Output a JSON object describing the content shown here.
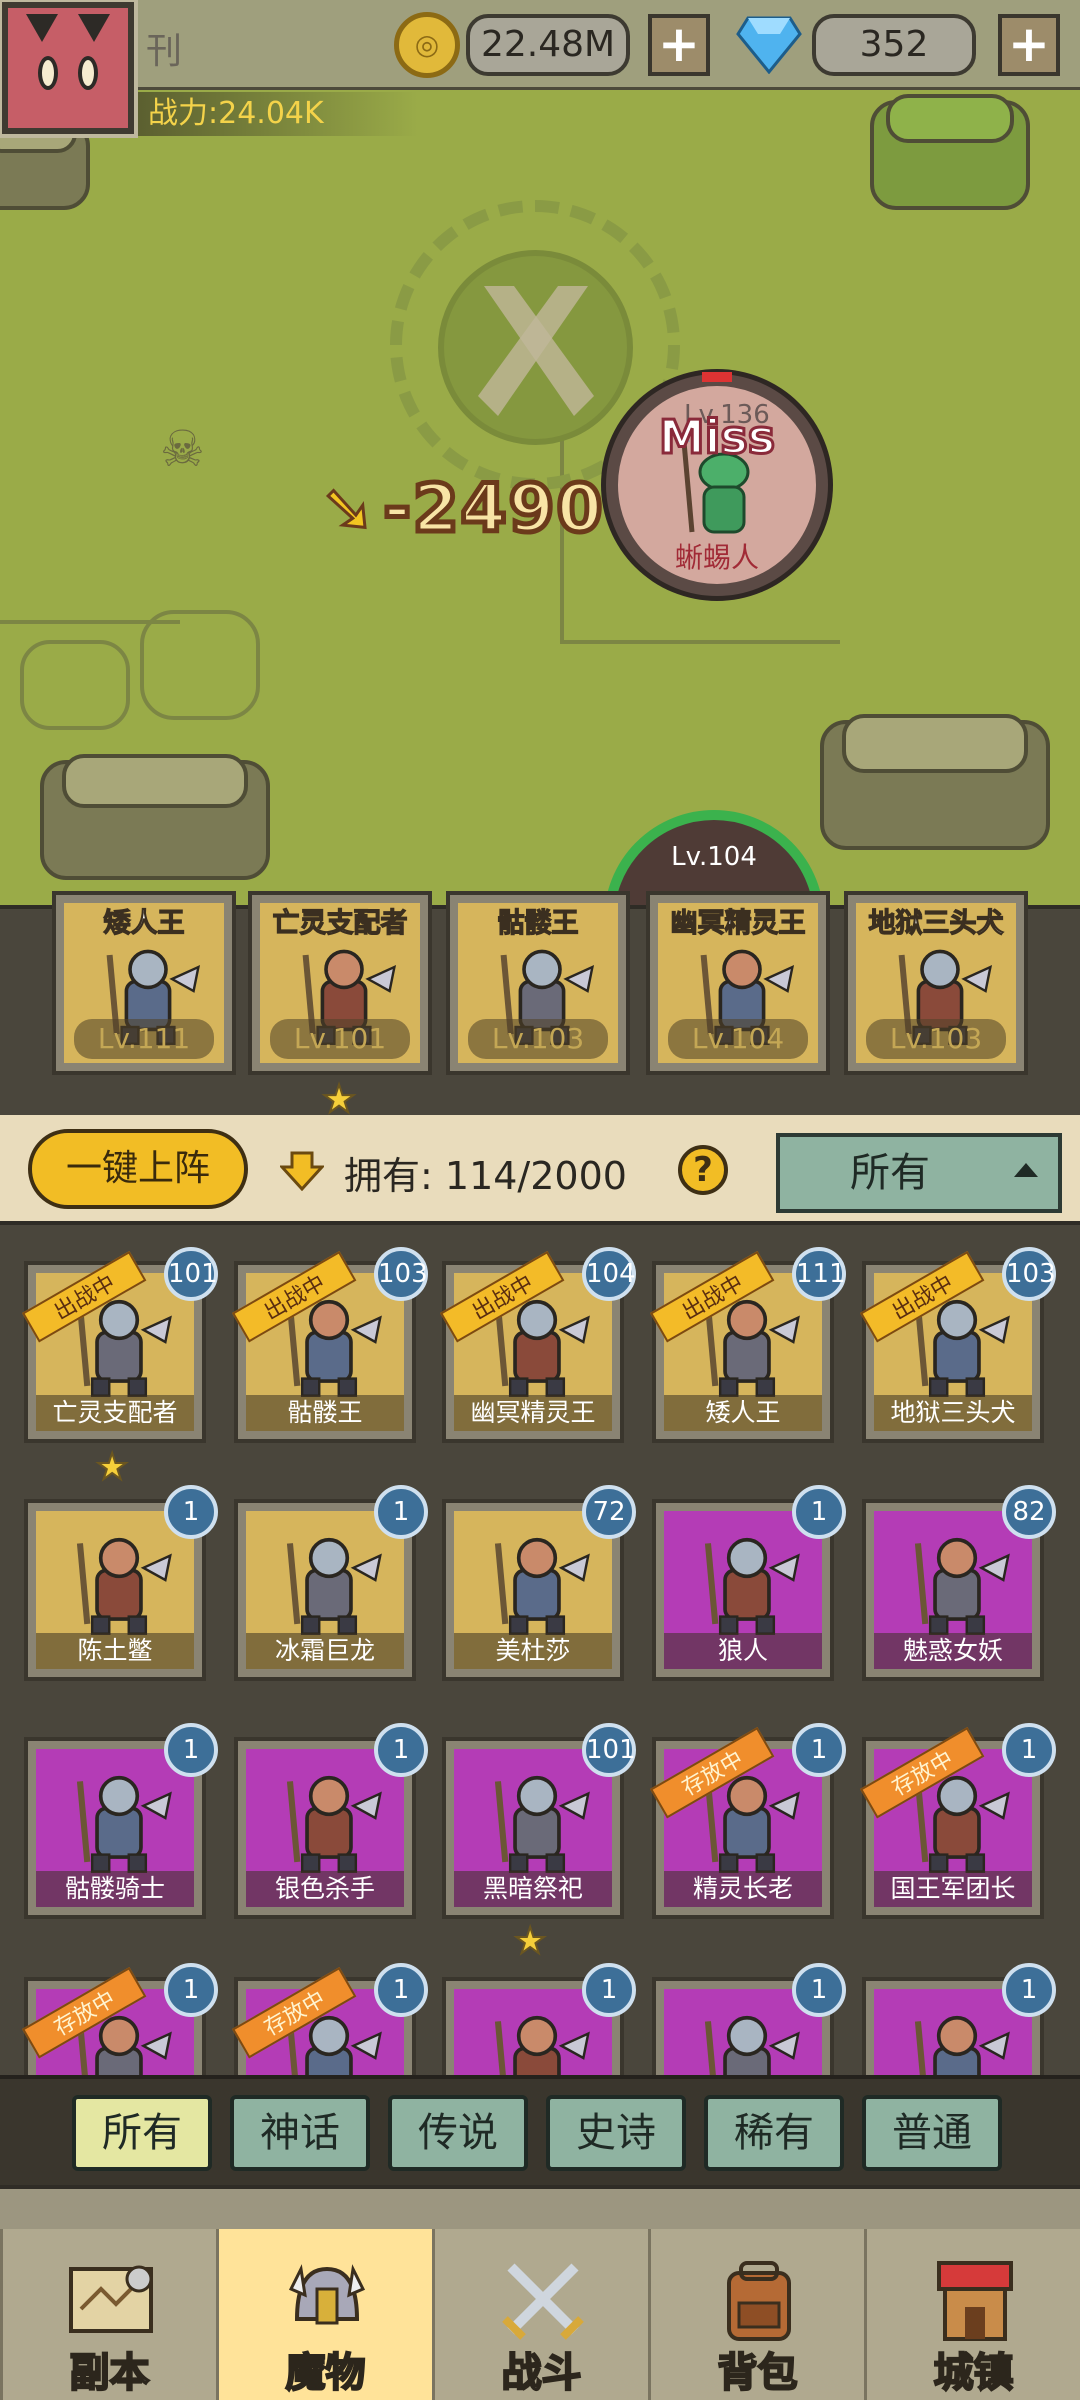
{
  "header": {
    "player_name": "刊",
    "gold": "22.48M",
    "gems": "352",
    "plus": "+",
    "power": "战力:24.04K"
  },
  "battle": {
    "damage": "-2490",
    "enemy": {
      "miss": "Miss",
      "level": "Lv.136",
      "name": "蜥蜴人"
    },
    "ally_level": "Lv.104"
  },
  "lineup": [
    {
      "name": "矮人王",
      "level": "Lv.111"
    },
    {
      "name": "亡灵支配者",
      "level": "Lv.101"
    },
    {
      "name": "骷髅王",
      "level": "Lv.103"
    },
    {
      "name": "幽冥精灵王",
      "level": "Lv.104"
    },
    {
      "name": "地狱三头犬",
      "level": "Lv.103"
    }
  ],
  "controls": {
    "deploy_label": "一键上阵",
    "owned_label": "拥有:",
    "owned_count": "114/2000",
    "help": "?",
    "filter_value": "所有"
  },
  "monsters": [
    {
      "name": "亡灵支配者",
      "level": "101",
      "tag": "出战中",
      "bg": "#d6b55c"
    },
    {
      "name": "骷髅王",
      "level": "103",
      "tag": "出战中",
      "bg": "#d6b55c"
    },
    {
      "name": "幽冥精灵王",
      "level": "104",
      "tag": "出战中",
      "bg": "#d6b55c"
    },
    {
      "name": "矮人王",
      "level": "111",
      "tag": "出战中",
      "bg": "#d6b55c"
    },
    {
      "name": "地狱三头犬",
      "level": "103",
      "tag": "出战中",
      "bg": "#d6b55c"
    },
    {
      "name": "陈土鳖",
      "level": "1",
      "tag": "",
      "bg": "#d6b55c"
    },
    {
      "name": "冰霜巨龙",
      "level": "1",
      "tag": "",
      "bg": "#d6b55c"
    },
    {
      "name": "美杜莎",
      "level": "72",
      "tag": "",
      "bg": "#d6b55c"
    },
    {
      "name": "狼人",
      "level": "1",
      "tag": "",
      "bg": "#b43cb6"
    },
    {
      "name": "魅惑女妖",
      "level": "82",
      "tag": "",
      "bg": "#b43cb6"
    },
    {
      "name": "骷髅骑士",
      "level": "1",
      "tag": "",
      "bg": "#b43cb6"
    },
    {
      "name": "银色杀手",
      "level": "1",
      "tag": "",
      "bg": "#b43cb6"
    },
    {
      "name": "黑暗祭祀",
      "level": "101",
      "tag": "",
      "bg": "#b43cb6"
    },
    {
      "name": "精灵长老",
      "level": "1",
      "tag": "存放中",
      "bg": "#b43cb6"
    },
    {
      "name": "国王军团长",
      "level": "1",
      "tag": "存放中",
      "bg": "#b43cb6"
    },
    {
      "name": "",
      "level": "1",
      "tag": "存放中",
      "bg": "#b43cb6"
    },
    {
      "name": "",
      "level": "1",
      "tag": "存放中",
      "bg": "#b43cb6"
    },
    {
      "name": "",
      "level": "1",
      "tag": "",
      "bg": "#b43cb6"
    },
    {
      "name": "",
      "level": "1",
      "tag": "",
      "bg": "#b43cb6"
    },
    {
      "name": "",
      "level": "1",
      "tag": "",
      "bg": "#b43cb6"
    }
  ],
  "rarity_tabs": [
    "所有",
    "神话",
    "传说",
    "史诗",
    "稀有",
    "普通"
  ],
  "nav": [
    {
      "label": "副本",
      "icon": "map-icon"
    },
    {
      "label": "魔物",
      "icon": "helmet-icon"
    },
    {
      "label": "战斗",
      "icon": "crossed-swords-icon"
    },
    {
      "label": "背包",
      "icon": "backpack-icon"
    },
    {
      "label": "城镇",
      "icon": "shop-icon"
    }
  ],
  "active_nav": "魔物",
  "active_rarity": "所有",
  "colors": {
    "accent_gold": "#f2bd25",
    "epic_purple": "#b43cb6",
    "legend_gold": "#d6b55c",
    "level_badge": "#3d6f98"
  }
}
